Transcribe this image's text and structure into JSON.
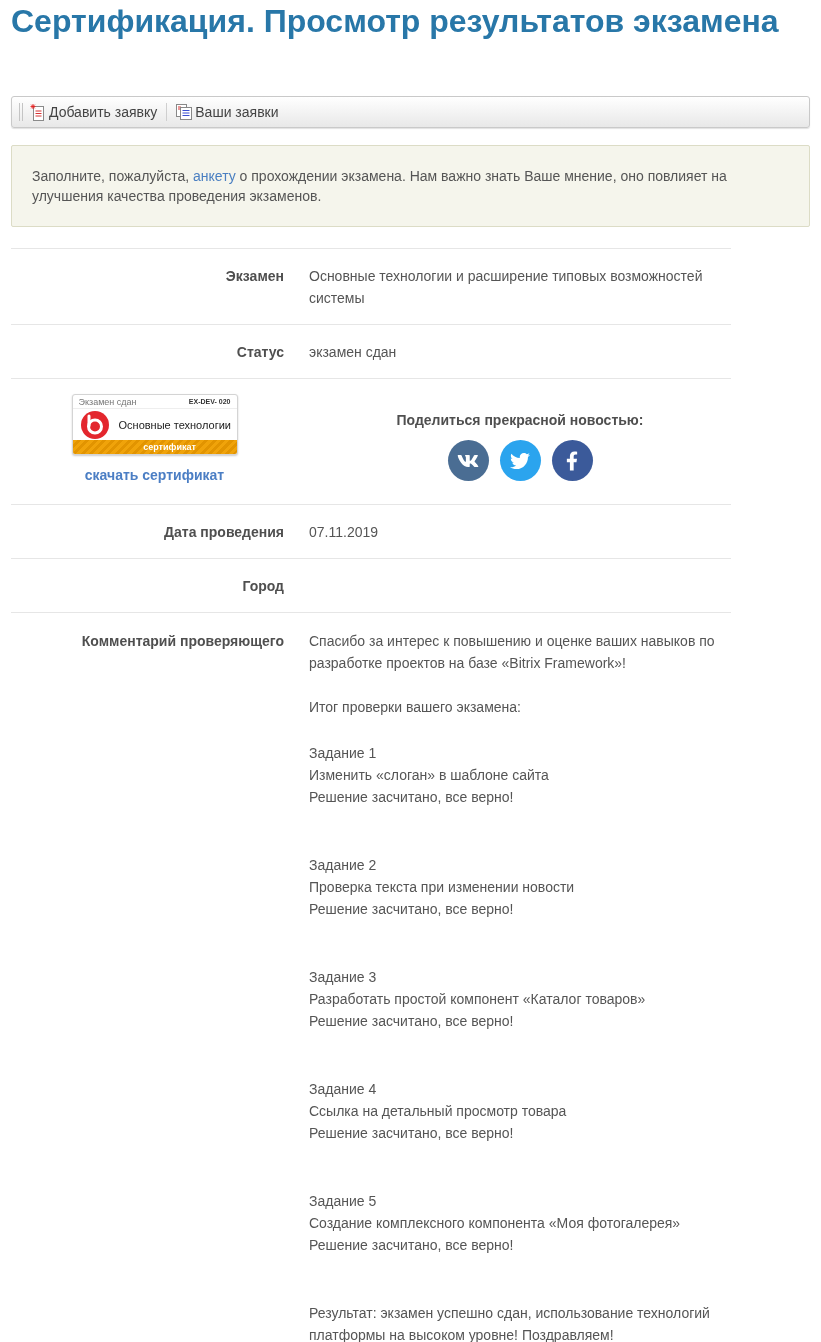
{
  "title": "Сертификация. Просмотр результатов экзамена",
  "toolbar": {
    "items": [
      {
        "kind": "add",
        "label": "Добавить заявку"
      },
      {
        "kind": "list",
        "label": "Ваши заявки"
      }
    ]
  },
  "notice": {
    "before": "Заполните, пожалуйста, ",
    "link": "анкету",
    "after": " о прохождении экзамена. Нам важно знать Ваше мнение, оно повлияет на улучшения качества проведения экзаменов."
  },
  "rows": [
    {
      "kind": "field",
      "label": "Экзамен",
      "value": "Основные технологии и расширение типовых возможностей системы"
    },
    {
      "kind": "field",
      "label": "Статус",
      "value": "экзамен сдан"
    },
    {
      "kind": "certificate",
      "certificate": {
        "status": "Экзамен сдан",
        "code": "EX-DEV- 020",
        "name": "Основные технологии",
        "ribbon": "сертификат"
      },
      "download": "скачать сертификат",
      "share": {
        "heading": "Поделиться прекрасной новостью:",
        "networks": [
          {
            "kind": "vk"
          },
          {
            "kind": "twitter"
          },
          {
            "kind": "facebook"
          }
        ]
      }
    },
    {
      "kind": "field",
      "label": "Дата проведения",
      "value": "07.11.2019"
    },
    {
      "kind": "field",
      "label": "Город"
    },
    {
      "kind": "comment",
      "label": "Комментарий проверяющего",
      "intro": "Спасибо за интерес к повышению и оценке ваших навыков по разработке проектов на базе «Bitrix Framework»!",
      "summary": "Итог проверки вашего экзамена:",
      "tasks": [
        {
          "number": "Задание 1",
          "title": "Изменить «слоган» в шаблоне сайта",
          "verdict": "Решение засчитано, все верно!"
        },
        {
          "number": "Задание 2",
          "title": "Проверка текста при изменении новости",
          "verdict": "Решение засчитано, все верно!"
        },
        {
          "number": "Задание 3",
          "title": "Разработать простой компонент «Каталог товаров»",
          "verdict": "Решение засчитано, все верно!"
        },
        {
          "number": "Задание 4",
          "title": "Ссылка на детальный просмотр товара",
          "verdict": "Решение засчитано, все верно!"
        },
        {
          "number": "Задание 5",
          "title": "Создание комплексного компонента «Моя фотогалерея»",
          "verdict": "Решение засчитано, все верно!"
        }
      ],
      "result": "Результат: экзамен успешно сдан, использование технологий платформы на высоком уровне! Поздравляем!"
    }
  ]
}
